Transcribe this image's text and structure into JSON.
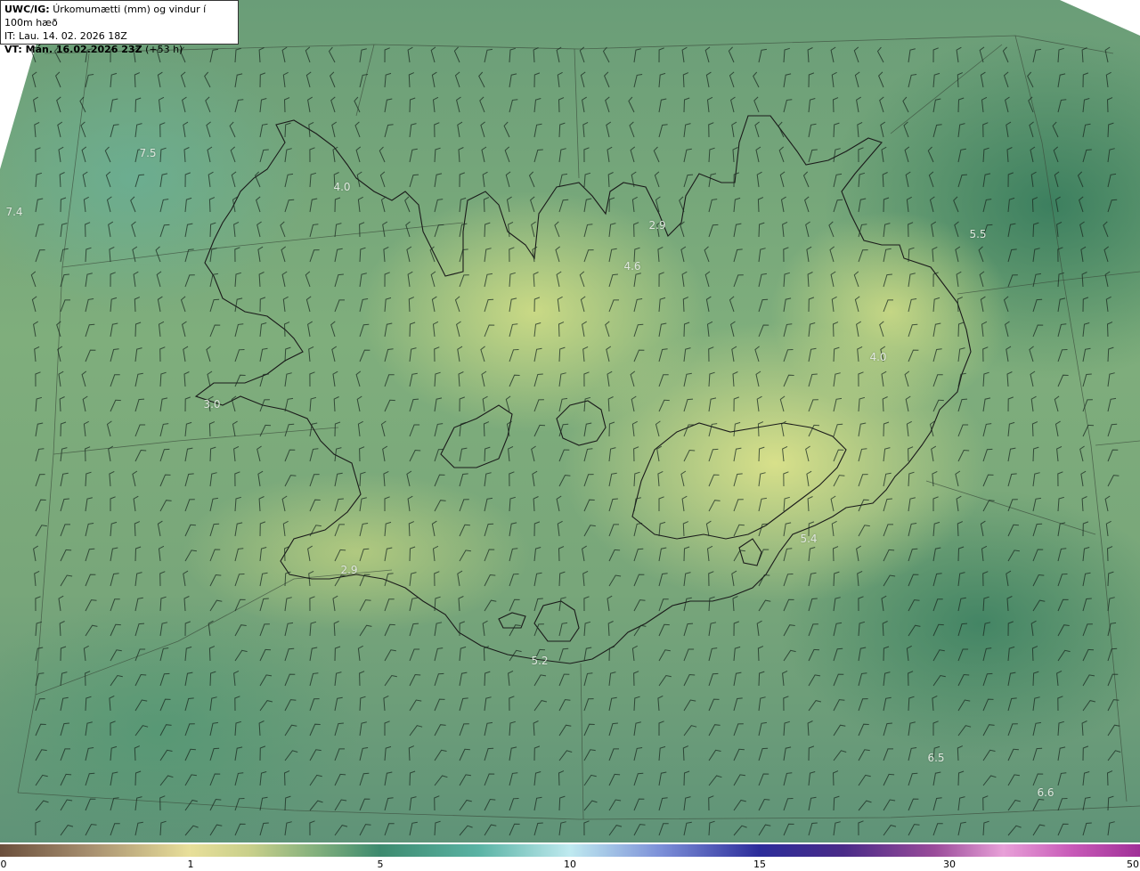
{
  "title": {
    "product": "UWC/IG:",
    "description": "Úrkomumætti (mm) og vindur í 100m hæð",
    "initial_time": "IT: Lau. 14. 02. 2026 18Z",
    "valid_time_label": "VT: Mán. 16.02.2026 23Z",
    "lead_time": "(+53 h)"
  },
  "map_labels": [
    "7.5",
    "7.4",
    "4.0",
    "2.9",
    "4.6",
    "5.5",
    "4.0",
    "3.0",
    "2.9",
    "5.4",
    "5.2",
    "6.5",
    "6.6"
  ],
  "colorbar": {
    "ticks": [
      "0",
      "1",
      "5",
      "10",
      "15",
      "30",
      "50"
    ],
    "unit": "mm"
  },
  "colors": {
    "low": "#e8df9a",
    "mid": "#3d8a6e",
    "high": "#a03098"
  }
}
